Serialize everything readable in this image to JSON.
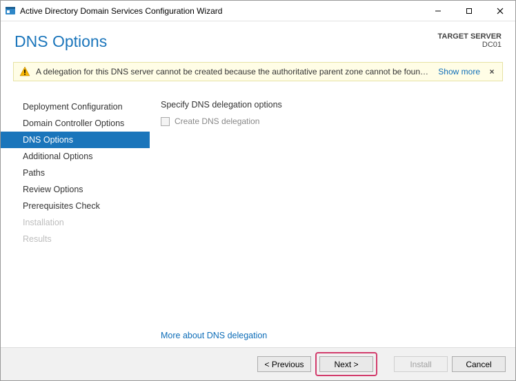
{
  "window": {
    "title": "Active Directory Domain Services Configuration Wizard"
  },
  "header": {
    "page_title": "DNS Options",
    "target_label": "TARGET SERVER",
    "target_name": "DC01"
  },
  "warning": {
    "text": "A delegation for this DNS server cannot be created because the authoritative parent zone cannot be found...",
    "show_more": "Show more",
    "close": "×"
  },
  "sidebar": {
    "items": [
      {
        "label": "Deployment Configuration",
        "state": "normal"
      },
      {
        "label": "Domain Controller Options",
        "state": "normal"
      },
      {
        "label": "DNS Options",
        "state": "active"
      },
      {
        "label": "Additional Options",
        "state": "normal"
      },
      {
        "label": "Paths",
        "state": "normal"
      },
      {
        "label": "Review Options",
        "state": "normal"
      },
      {
        "label": "Prerequisites Check",
        "state": "normal"
      },
      {
        "label": "Installation",
        "state": "disabled"
      },
      {
        "label": "Results",
        "state": "disabled"
      }
    ]
  },
  "content": {
    "section_label": "Specify DNS delegation options",
    "checkbox_label": "Create DNS delegation",
    "more_link": "More about DNS delegation"
  },
  "footer": {
    "previous": "< Previous",
    "next": "Next >",
    "install": "Install",
    "cancel": "Cancel"
  }
}
